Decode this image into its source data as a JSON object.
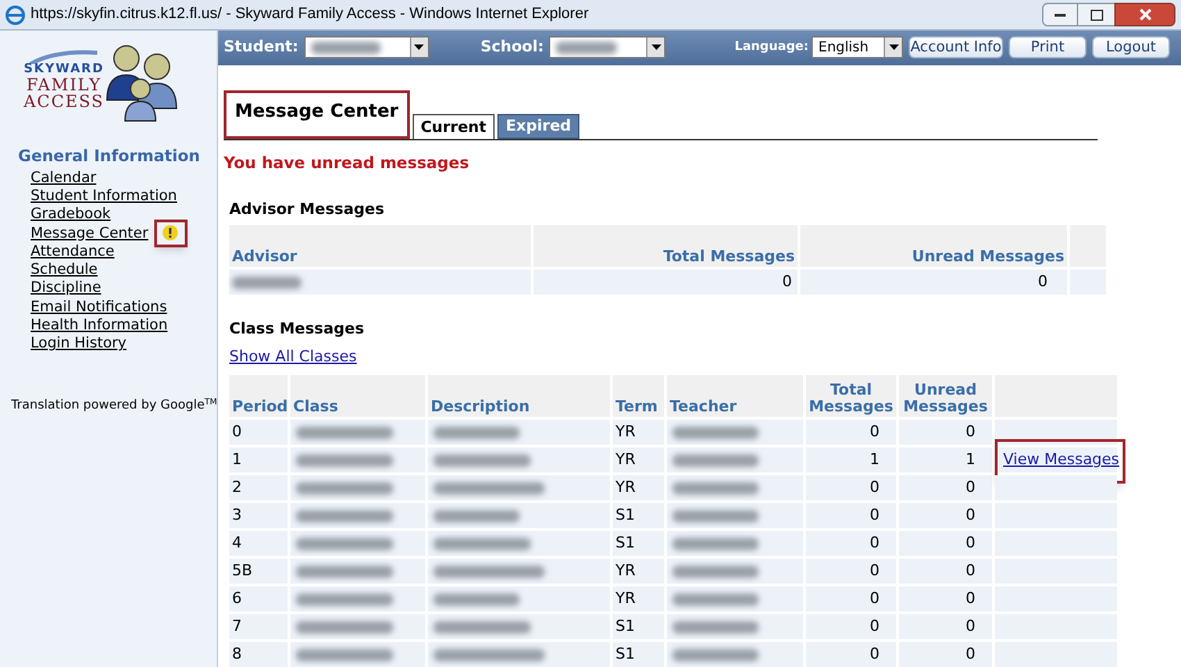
{
  "window": {
    "title": "https://skyfin.citrus.k12.fl.us/ - Skyward Family Access - Windows Internet Explorer"
  },
  "logo": {
    "line_1": "SKYWARD",
    "line_2": "FAMILY",
    "line_3": "ACCESS"
  },
  "sidebar": {
    "heading": "General Information",
    "items": [
      {
        "label": "Calendar",
        "alert": false,
        "highlighted": false
      },
      {
        "label": "Student Information",
        "alert": false,
        "highlighted": false
      },
      {
        "label": "Gradebook",
        "alert": false,
        "highlighted": false
      },
      {
        "label": "Message Center",
        "alert": true,
        "highlighted": true
      },
      {
        "label": "Attendance",
        "alert": false,
        "highlighted": false
      },
      {
        "label": "Schedule",
        "alert": false,
        "highlighted": false
      },
      {
        "label": "Discipline",
        "alert": false,
        "highlighted": false
      },
      {
        "label": "Email Notifications",
        "alert": false,
        "highlighted": false
      },
      {
        "label": "Health Information",
        "alert": false,
        "highlighted": false
      },
      {
        "label": "Login History",
        "alert": false,
        "highlighted": false
      }
    ],
    "footer": "Translation powered by Google",
    "footer_mark": "TM"
  },
  "topbar": {
    "student_label": "Student:",
    "school_label": "School:",
    "language_label": "Language:",
    "language_value": "English",
    "buttons": [
      "Account Info",
      "Print",
      "Logout"
    ]
  },
  "page": {
    "title": "Message Center",
    "title_highlighted": true,
    "tabs": [
      {
        "label": "Current",
        "selected": true
      },
      {
        "label": "Expired",
        "selected": false
      }
    ],
    "notice": "You have unread messages"
  },
  "advisor_messages": {
    "title": "Advisor Messages",
    "columns": [
      "Advisor",
      "Total Messages",
      "Unread Messages"
    ],
    "rows": [
      {
        "total": "0",
        "unread": "0"
      }
    ]
  },
  "class_messages": {
    "title": "Class Messages",
    "show_all": "Show All Classes",
    "columns": [
      "Period",
      "Class",
      "Description",
      "Term",
      "Teacher",
      "Total Messages",
      "Unread Messages"
    ],
    "rows": [
      {
        "period": "0",
        "term": "YR",
        "total": "0",
        "unread": "0"
      },
      {
        "period": "1",
        "term": "YR",
        "total": "1",
        "unread": "1",
        "action": "View Messages",
        "highlighted": true
      },
      {
        "period": "2",
        "term": "YR",
        "total": "0",
        "unread": "0"
      },
      {
        "period": "3",
        "term": "S1",
        "total": "0",
        "unread": "0"
      },
      {
        "period": "4",
        "term": "S1",
        "total": "0",
        "unread": "0"
      },
      {
        "period": "5B",
        "term": "YR",
        "total": "0",
        "unread": "0"
      },
      {
        "period": "6",
        "term": "YR",
        "total": "0",
        "unread": "0"
      },
      {
        "period": "7",
        "term": "S1",
        "total": "0",
        "unread": "0"
      },
      {
        "period": "8",
        "term": "S1",
        "total": "0",
        "unread": "0"
      }
    ]
  }
}
